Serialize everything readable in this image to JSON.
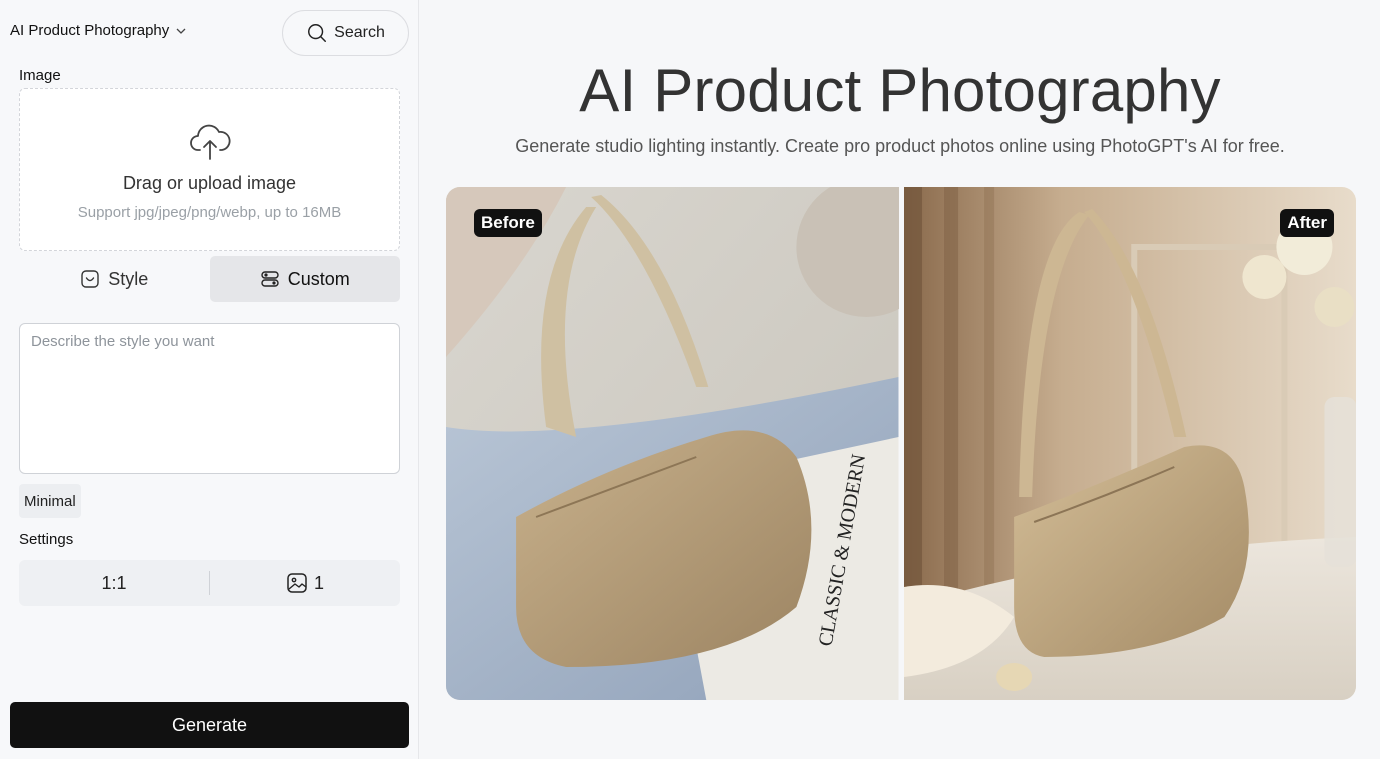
{
  "sidebar": {
    "tool_name": "AI Product Photography",
    "search_label": "Search",
    "image_label": "Image",
    "upload": {
      "title": "Drag or upload image",
      "subtitle": "Support jpg/jpeg/png/webp, up to 16MB"
    },
    "tabs": [
      {
        "label": "Style",
        "icon": "smile-frame-icon",
        "active": false
      },
      {
        "label": "Custom",
        "icon": "sliders-icon",
        "active": true
      }
    ],
    "prompt_placeholder": "Describe the style you want",
    "chips": [
      "Minimal"
    ],
    "settings_label": "Settings",
    "settings": {
      "aspect_ratio": "1:1",
      "image_count": "1"
    },
    "generate_label": "Generate"
  },
  "main": {
    "title": "AI Product Photography",
    "subtitle": "Generate studio lighting instantly. Create pro product photos online using PhotoGPT's AI for free.",
    "before_label": "Before",
    "after_label": "After",
    "before_scene_text": "CLASSIC & MODERN"
  },
  "colors": {
    "accent": "#111111",
    "active_tab": "#e5e6e9",
    "bag": "#b9a07c"
  }
}
